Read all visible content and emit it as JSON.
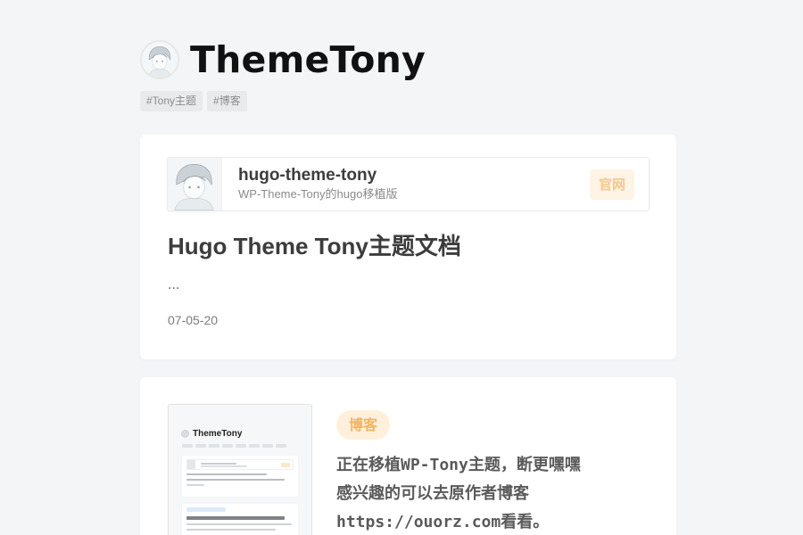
{
  "site": {
    "title": "ThemeTony",
    "avatar_icon": "avatar-illustration-icon",
    "tags": [
      "#Tony主题",
      "#博客"
    ]
  },
  "posts": [
    {
      "project": {
        "name": "hugo-theme-tony",
        "description": "WP-Theme-Tony的hugo移植版",
        "button_label": "官网",
        "thumb_icon": "avatar-illustration-icon"
      },
      "title": "Hugo Theme Tony主题文档",
      "excerpt": "...",
      "date": "07-05-20"
    },
    {
      "category": "博客",
      "text_lines": [
        "正在移植WP-Tony主题，断更嘿嘿",
        "感兴趣的可以去原作者博客",
        "https://ouorz.com看看。"
      ],
      "thumbnail": {
        "title": "ThemeTony"
      }
    }
  ],
  "colors": {
    "background": "#f4f5f7",
    "card": "#ffffff",
    "accent_orange": "#f3b35e",
    "accent_orange_bg": "#fff0db"
  }
}
